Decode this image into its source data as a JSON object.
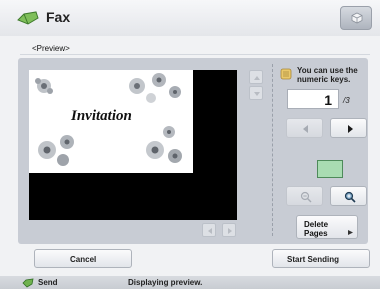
{
  "header": {
    "title": "Fax",
    "app_icon": "fax-icon",
    "top_right_icon": "settings-cube-icon"
  },
  "breadcrumb": "<Preview>",
  "preview": {
    "document_title": "Invitation"
  },
  "pager": {
    "hint": "You can use the numeric keys.",
    "current_page": "1",
    "total_pages": "/3"
  },
  "buttons": {
    "delete_pages": "Delete Pages",
    "cancel": "Cancel",
    "start_sending": "Start Sending"
  },
  "status": {
    "left": "Send",
    "message": "Displaying preview."
  },
  "icons": {
    "prev": "prev-page-icon",
    "next": "next-page-icon",
    "zoom_out": "zoom-out-icon",
    "zoom_in": "zoom-in-icon",
    "scroll_up": "scroll-up-icon",
    "scroll_down": "scroll-down-icon",
    "scroll_left": "scroll-left-icon",
    "scroll_right": "scroll-right-icon"
  },
  "colors": {
    "swatch": "#a9dcb2",
    "panel": "#c8ccd4"
  }
}
